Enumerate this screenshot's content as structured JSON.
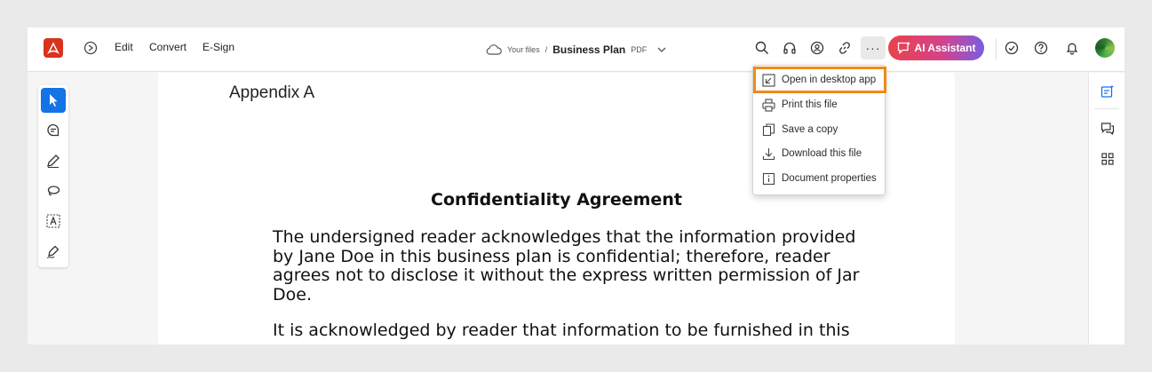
{
  "topbar": {
    "menu": {
      "edit": "Edit",
      "convert": "Convert",
      "esign": "E-Sign"
    },
    "breadcrumb": {
      "folder": "Your files",
      "separator": "/",
      "file_name": "Business Plan",
      "file_type": "PDF"
    },
    "more_label": "···",
    "ai_assistant_label": "AI Assistant"
  },
  "more_menu": {
    "items": [
      {
        "label": "Open in desktop app",
        "icon": "open-external-icon"
      },
      {
        "label": "Print this file",
        "icon": "printer-icon"
      },
      {
        "label": "Save a copy",
        "icon": "copy-icon"
      },
      {
        "label": "Download this file",
        "icon": "download-icon"
      },
      {
        "label": "Document properties",
        "icon": "info-icon"
      }
    ],
    "highlight_color": "#f18a16"
  },
  "document": {
    "appendix": "Appendix A",
    "title": "Confidentiality Agreement",
    "para1_lines": [
      "The undersigned reader acknowledges that the information provided",
      "by Jane Doe in this business plan is confidential; therefore, reader",
      "agrees not to disclose it without the express written permission of Jar",
      "Doe."
    ],
    "para2_line": "It is acknowledged by reader that information to be furnished in this"
  },
  "colors": {
    "accent": "#1473e6",
    "brand": "#d7331e"
  }
}
